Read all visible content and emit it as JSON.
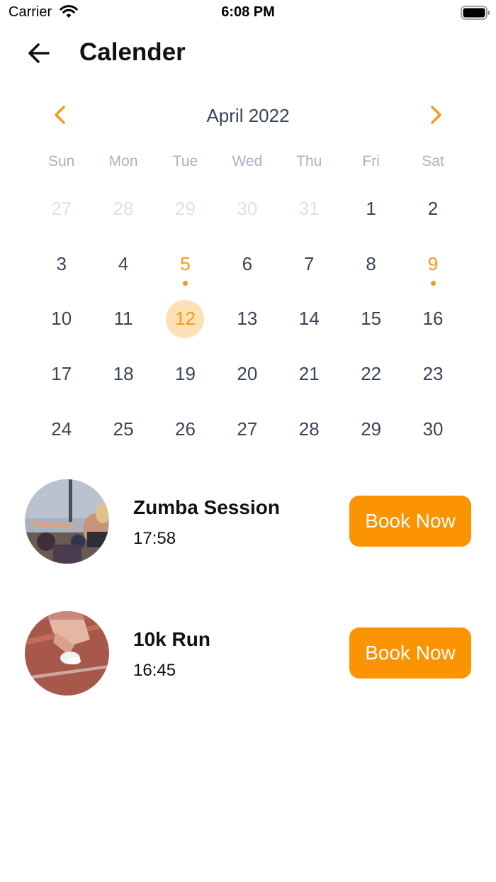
{
  "status_bar": {
    "carrier": "Carrier",
    "time": "6:08 PM"
  },
  "header": {
    "title": "Calender",
    "back_icon": "arrow-left-icon"
  },
  "calendar": {
    "month_label": "April 2022",
    "prev_icon": "chevron-left-icon",
    "next_icon": "chevron-right-icon",
    "weekdays": [
      "Sun",
      "Mon",
      "Tue",
      "Wed",
      "Thu",
      "Fri",
      "Sat"
    ],
    "days": [
      {
        "label": "27",
        "state": "muted"
      },
      {
        "label": "28",
        "state": "muted"
      },
      {
        "label": "29",
        "state": "muted"
      },
      {
        "label": "30",
        "state": "muted"
      },
      {
        "label": "31",
        "state": "muted"
      },
      {
        "label": "1",
        "state": "normal"
      },
      {
        "label": "2",
        "state": "normal"
      },
      {
        "label": "3",
        "state": "normal"
      },
      {
        "label": "4",
        "state": "normal"
      },
      {
        "label": "5",
        "state": "event"
      },
      {
        "label": "6",
        "state": "normal"
      },
      {
        "label": "7",
        "state": "normal"
      },
      {
        "label": "8",
        "state": "normal"
      },
      {
        "label": "9",
        "state": "event"
      },
      {
        "label": "10",
        "state": "normal"
      },
      {
        "label": "11",
        "state": "normal"
      },
      {
        "label": "12",
        "state": "selected"
      },
      {
        "label": "13",
        "state": "normal"
      },
      {
        "label": "14",
        "state": "normal"
      },
      {
        "label": "15",
        "state": "normal"
      },
      {
        "label": "16",
        "state": "normal"
      },
      {
        "label": "17",
        "state": "normal"
      },
      {
        "label": "18",
        "state": "normal"
      },
      {
        "label": "19",
        "state": "normal"
      },
      {
        "label": "20",
        "state": "normal"
      },
      {
        "label": "21",
        "state": "normal"
      },
      {
        "label": "22",
        "state": "normal"
      },
      {
        "label": "23",
        "state": "normal"
      },
      {
        "label": "24",
        "state": "normal"
      },
      {
        "label": "25",
        "state": "normal"
      },
      {
        "label": "26",
        "state": "normal"
      },
      {
        "label": "27",
        "state": "normal"
      },
      {
        "label": "28",
        "state": "normal"
      },
      {
        "label": "29",
        "state": "normal"
      },
      {
        "label": "30",
        "state": "normal"
      }
    ]
  },
  "events": [
    {
      "name": "Zumba Session",
      "time": "17:58",
      "button_label": "Book Now"
    },
    {
      "name": "10k Run",
      "time": "16:45",
      "button_label": "Book Now"
    }
  ],
  "colors": {
    "accent": "#fb9302",
    "event_text": "#f7971e",
    "selected_bg": "#fde1b6",
    "day_text": "#3a4556",
    "muted_day": "#dde2ea",
    "weekday_text": "#a9b3c3"
  }
}
